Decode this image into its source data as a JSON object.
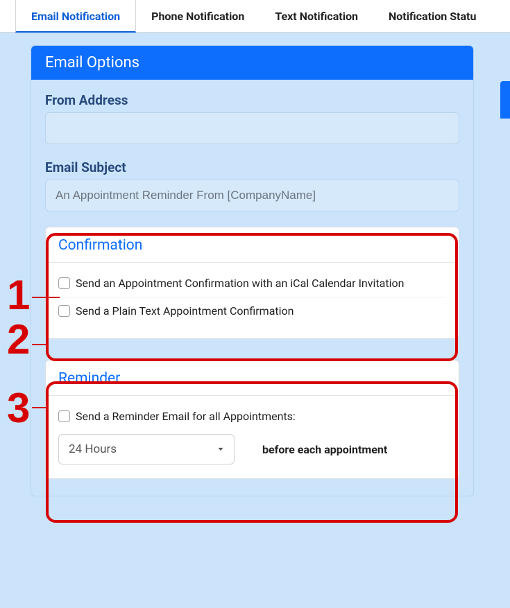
{
  "tabs": {
    "email": "Email Notification",
    "phone": "Phone Notification",
    "text": "Text Notification",
    "status": "Notification Statu"
  },
  "panel": {
    "title": "Email Options",
    "from_label": "From Address",
    "from_value": "",
    "subject_label": "Email Subject",
    "subject_value": "An Appointment Reminder From [CompanyName]"
  },
  "confirmation": {
    "title": "Confirmation",
    "opt_ical": "Send an Appointment Confirmation with an iCal Calendar Invitation",
    "opt_plain": "Send a Plain Text Appointment Confirmation"
  },
  "reminder": {
    "title": "Reminder",
    "opt_all": "Send a Reminder Email for all Appointments:",
    "lead_time": "24 Hours",
    "caption": "before each appointment"
  },
  "annotations": {
    "n1": "1",
    "n2": "2",
    "n3": "3"
  }
}
